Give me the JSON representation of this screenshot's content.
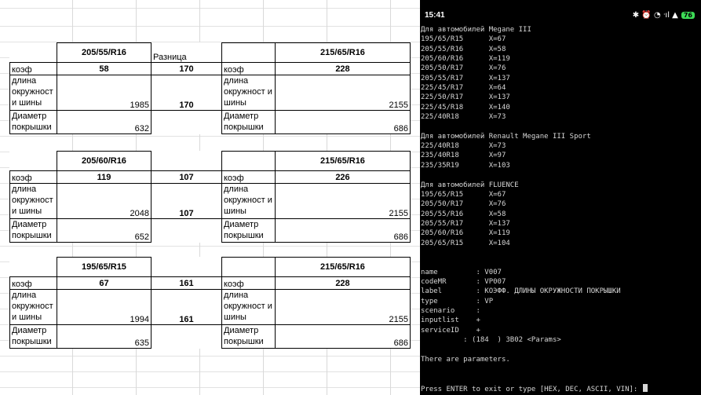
{
  "blocks": [
    {
      "left_size": "205/55/R16",
      "diff_label": "Разница",
      "right_size": "215/65/R16",
      "coef_label": "коэф",
      "left_coef": "58",
      "diff_coef": "170",
      "right_coef": "228",
      "length_label": "длина окружност и шины",
      "left_length": "1985",
      "diff_length": "170",
      "right_length": "2155",
      "diameter_label": "Диаметр покрышки",
      "left_diameter": "632",
      "right_diameter": "686"
    },
    {
      "left_size": "205/60/R16",
      "diff_label": "",
      "right_size": "215/65/R16",
      "coef_label": "коэф",
      "left_coef": "119",
      "diff_coef": "107",
      "right_coef": "226",
      "length_label": "длина окружност и шины",
      "left_length": "2048",
      "diff_length": "107",
      "right_length": "2155",
      "diameter_label": "Диаметр покрышки",
      "left_diameter": "652",
      "right_diameter": "686"
    },
    {
      "left_size": "195/65/R15",
      "diff_label": "",
      "right_size": "215/65/R16",
      "coef_label": "коэф",
      "left_coef": "67",
      "diff_coef": "161",
      "right_coef": "228",
      "length_label": "длина окружност и шины",
      "left_length": "1994",
      "diff_length": "161",
      "right_length": "2155",
      "diameter_label": "Диаметр покрышки",
      "left_diameter": "635",
      "right_diameter": "686"
    }
  ],
  "phone": {
    "time": "15:41",
    "status_icons": "✱ ⏰ ◔ ᐧıl ▲",
    "battery": "76"
  },
  "terminal": {
    "lines": [
      "Для автомобилей Megane III",
      "195/65/R15      X=67",
      "205/55/R16      X=58",
      "205/60/R16      X=119",
      "205/50/R17      X=76",
      "205/55/R17      X=137",
      "225/45/R17      X=64",
      "225/50/R17      X=137",
      "225/45/R18      X=140",
      "225/40R18       X=73",
      "",
      "Для автомобилей Renault Megane III Sport",
      "225/40R18       X=73",
      "235/40R18       X=97",
      "235/35R19       X=103",
      "",
      "Для автомобилей FLUENCE",
      "195/65/R15      X=67",
      "205/50/R17      X=76",
      "205/55/R16      X=58",
      "205/55/R17      X=137",
      "205/60/R16      X=119",
      "205/65/R15      X=104",
      "",
      "",
      "name         : V007",
      "codeMR       : VP007",
      "label        : КОЭФФ. ДЛИНЫ ОКРУЖНОСТИ ПОКРЫШКИ",
      "type         : VP",
      "scenario     :",
      "inputlist    +",
      "serviceID    +",
      "          : (184  ) 3B02 <Params>",
      "",
      "There are parameters.",
      "",
      ""
    ],
    "prompt": "Press ENTER to exit or type [HEX, DEC, ASCII, VIN]: "
  }
}
